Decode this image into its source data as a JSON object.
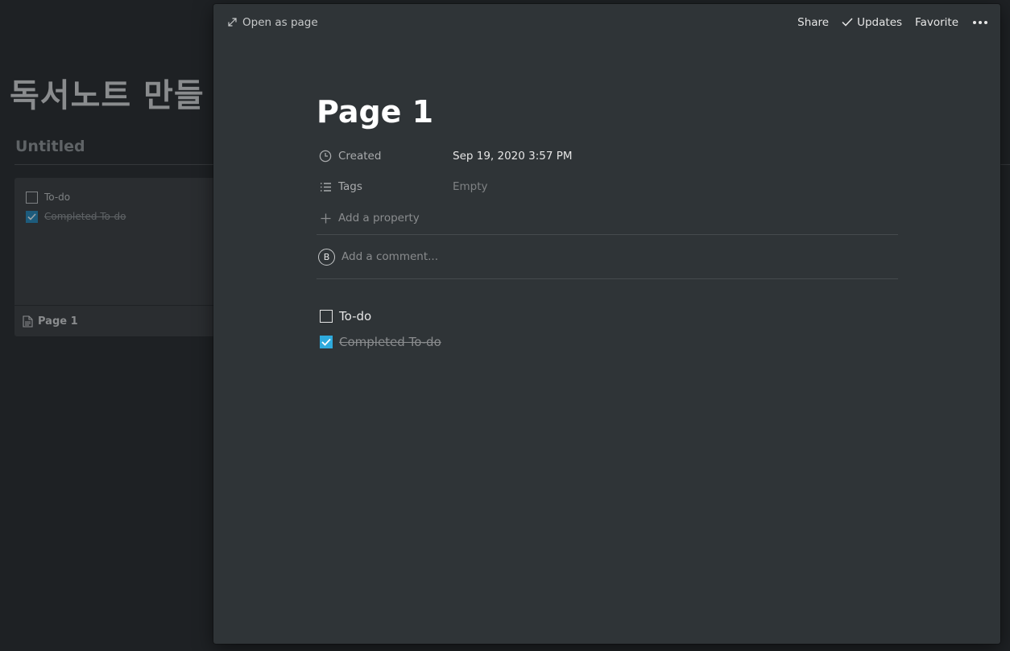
{
  "background": {
    "title": "독서노트 만들",
    "view_name": "Untitled",
    "card": {
      "todos": [
        {
          "label": "To-do",
          "checked": false
        },
        {
          "label": "Completed To-do",
          "checked": true
        }
      ],
      "title": "Page 1"
    }
  },
  "topbar": {
    "open_as_page": "Open as page",
    "share": "Share",
    "updates": "Updates",
    "favorite": "Favorite"
  },
  "page": {
    "title": "Page 1",
    "properties": [
      {
        "name": "Created",
        "icon": "clock-icon",
        "value": "Sep 19, 2020 3:57 PM"
      },
      {
        "name": "Tags",
        "icon": "list-icon",
        "value": "Empty"
      }
    ],
    "add_property": "Add a property",
    "comment": {
      "avatar_letter": "B",
      "placeholder": "Add a comment..."
    },
    "todos": [
      {
        "label": "To-do",
        "checked": false
      },
      {
        "label": "Completed To-do",
        "checked": true
      }
    ]
  },
  "colors": {
    "background": "#1e2124",
    "panel": "#2f3437",
    "checkbox_accent": "#2eaadc"
  }
}
